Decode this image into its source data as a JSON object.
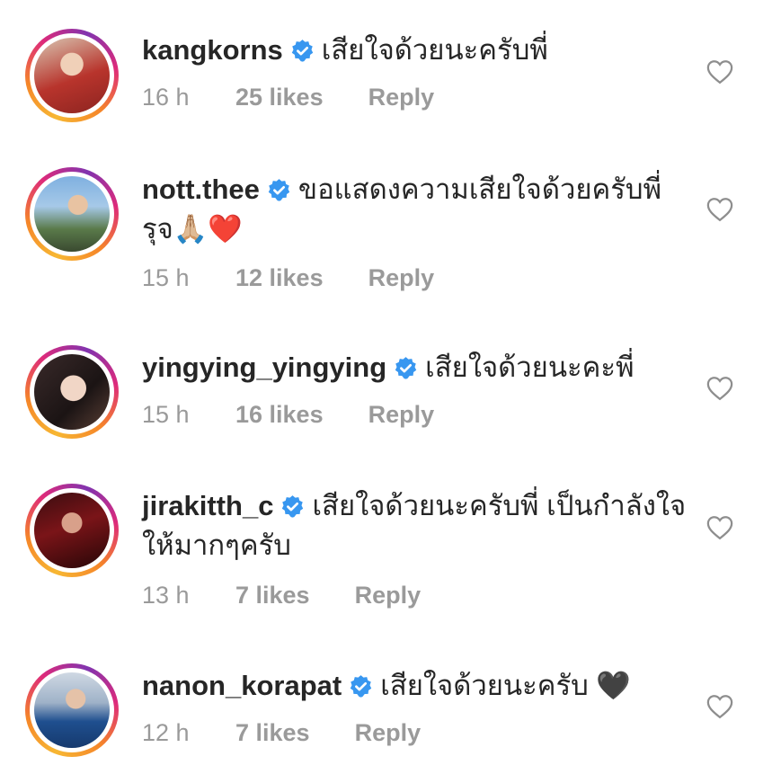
{
  "colors": {
    "text": "#262626",
    "meta": "#9a9a9a",
    "verified": "#3897f0",
    "heart_outline": "#8e8e8e"
  },
  "comments": [
    {
      "username": "kangkorns",
      "text": "เสียใจด้วยนะครับพี่",
      "time": "16 h",
      "likes": "25 likes",
      "reply": "Reply",
      "avatar": "profile-photo"
    },
    {
      "username": "nott.thee",
      "text": "ขอแสดงความเสียใจด้วยครับพี่รุจ🙏🏼❤️",
      "time": "15 h",
      "likes": "12 likes",
      "reply": "Reply",
      "avatar": "profile-photo"
    },
    {
      "username": "yingying_yingying",
      "text": "เสียใจด้วยนะคะพี่",
      "time": "15 h",
      "likes": "16 likes",
      "reply": "Reply",
      "avatar": "profile-photo"
    },
    {
      "username": "jirakitth_c",
      "text": "เสียใจด้วยนะครับพี่ เป็นกำลังใจให้มากๆครับ",
      "time": "13 h",
      "likes": "7 likes",
      "reply": "Reply",
      "avatar": "profile-photo"
    },
    {
      "username": "nanon_korapat",
      "text": "เสียใจด้วยนะครับ 🖤",
      "time": "12 h",
      "likes": "7 likes",
      "reply": "Reply",
      "avatar": "profile-photo"
    }
  ]
}
